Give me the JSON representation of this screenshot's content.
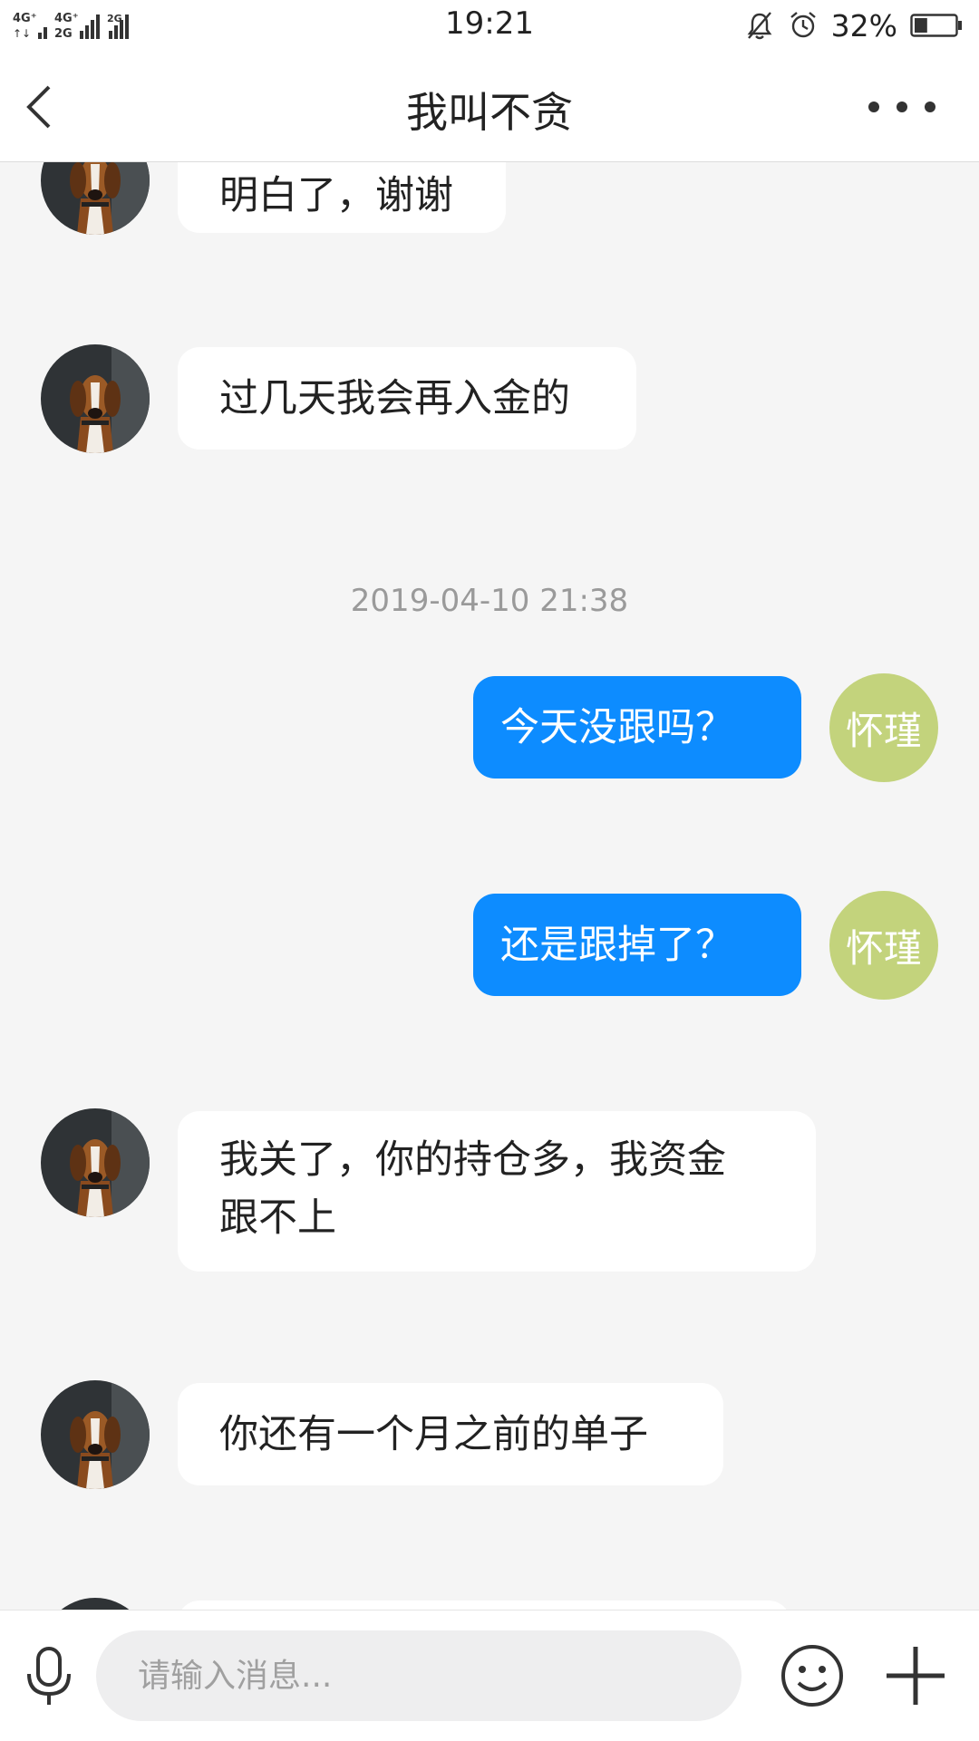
{
  "status_bar": {
    "network_left": "4G⁺",
    "network_mid": "4G⁺ 2G",
    "network_right": "2G",
    "time": "19:21",
    "battery_percent": "32%",
    "battery_level": 0.32,
    "icons": [
      "mute-bell-icon",
      "alarm-icon",
      "battery-icon"
    ]
  },
  "header": {
    "back_icon": "chevron-left-icon",
    "title": "我叫不贪",
    "more_icon": "more-dots-icon"
  },
  "me": {
    "avatar_text": "怀瑾",
    "avatar_color": "#c3d37c"
  },
  "colors": {
    "outgoing_bubble": "#0d8cff",
    "incoming_bubble": "#ffffff",
    "background": "#f5f5f5"
  },
  "messages": [
    {
      "from": "them",
      "text": "明白了，谢谢"
    },
    {
      "from": "them",
      "text": "过几天我会再入金的"
    },
    {
      "type": "timestamp",
      "text": "2019-04-10 21:38"
    },
    {
      "from": "me",
      "text": "今天没跟吗？"
    },
    {
      "from": "me",
      "text": "还是跟掉了？"
    },
    {
      "from": "them",
      "lines": [
        "我关了，你的持仓多，我资金",
        "跟不上"
      ]
    },
    {
      "from": "them",
      "text": "你还有一个月之前的单子"
    }
  ],
  "input_bar": {
    "placeholder": "请输入消息...",
    "icons": [
      "microphone-icon",
      "emoji-icon",
      "plus-icon"
    ]
  }
}
